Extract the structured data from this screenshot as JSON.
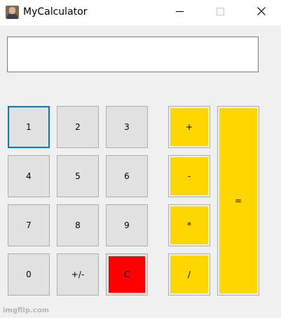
{
  "window": {
    "title": "MyCalculator",
    "app_icon": "user-photo-icon",
    "controls": [
      "minimize-icon",
      "maximize-icon",
      "close-icon"
    ]
  },
  "display": {
    "value": ""
  },
  "keys": {
    "k1": "1",
    "k2": "2",
    "k3": "3",
    "k4": "4",
    "k5": "5",
    "k6": "6",
    "k7": "7",
    "k8": "8",
    "k9": "9",
    "k0": "0",
    "negate": "+/-",
    "clear": "C",
    "plus": "+",
    "minus": "-",
    "multiply": "*",
    "divide": "/",
    "equals": "="
  },
  "colors": {
    "operator": "#ffd700",
    "clear": "#ff0000",
    "digit": "#e1e1e1",
    "focus": "#0078d7"
  },
  "watermark": "imgflip.com"
}
